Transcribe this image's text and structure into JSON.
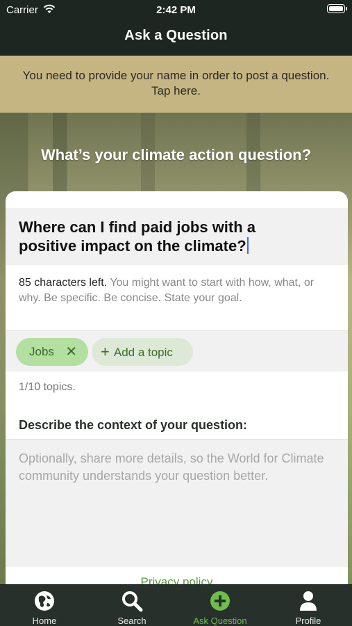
{
  "status_bar": {
    "carrier": "Carrier",
    "time": "2:42 PM"
  },
  "nav": {
    "title": "Ask a Question"
  },
  "banner": {
    "line1": "You need to provide your name in order to post a question.",
    "line2": "Tap here."
  },
  "hero": {
    "title": "What’s your climate action question?"
  },
  "question": {
    "line1": "Where can I find paid jobs with a",
    "line2": "positive impact on the climate?"
  },
  "hint": {
    "count": "85 characters left.",
    "text": " You might want to start with how, what, or why. Be specific. Be concise. State your goal."
  },
  "topics": {
    "selected": "Jobs",
    "add_label": "Add a topic",
    "count": "1/10 topics."
  },
  "context": {
    "label": "Describe the context of your question:",
    "placeholder": "Optionally, share more details, so the World for Climate community understands your question better."
  },
  "links": {
    "privacy": "Privacy policy"
  },
  "tabs": [
    {
      "label": "Home",
      "icon": "globe-icon"
    },
    {
      "label": "Search",
      "icon": "search-icon"
    },
    {
      "label": "Ask Question",
      "icon": "plus-circle-icon",
      "active": true
    },
    {
      "label": "Profile",
      "icon": "person-icon"
    }
  ],
  "colors": {
    "accent": "#6fbd4a",
    "banner": "#c5b583",
    "chip": "#b3dfa0"
  }
}
